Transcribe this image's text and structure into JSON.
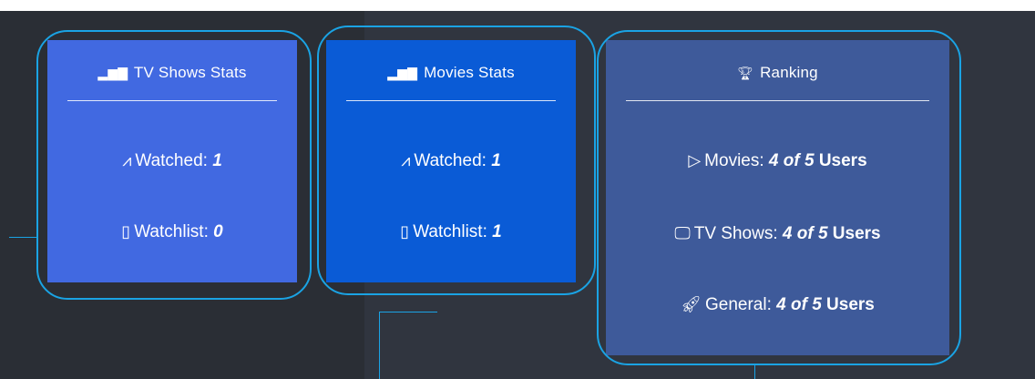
{
  "tv_card": {
    "title": "TV Shows Stats",
    "title_icon": "bar-chart-icon",
    "watched_label": "Watched:",
    "watched_value": "1",
    "watchlist_label": "Watchlist:",
    "watchlist_value": "0",
    "bg": "#4169e1"
  },
  "movies_card": {
    "title": "Movies Stats",
    "title_icon": "bar-chart-icon",
    "watched_label": "Watched:",
    "watched_value": "1",
    "watchlist_label": "Watchlist:",
    "watchlist_value": "1",
    "bg": "#0a5bd6"
  },
  "ranking_card": {
    "title": "Ranking",
    "title_icon": "trophy-icon",
    "movies_label": "Movies:",
    "movies_value": "4 of 5",
    "tv_label": "TV Shows:",
    "tv_value": "4 of 5",
    "general_label": "General:",
    "general_value": "4 of 5",
    "users_word": "Users",
    "bg": "#3e5a9a"
  },
  "colors": {
    "background": "#30353f",
    "highlight_outline": "#1aa3e4"
  }
}
